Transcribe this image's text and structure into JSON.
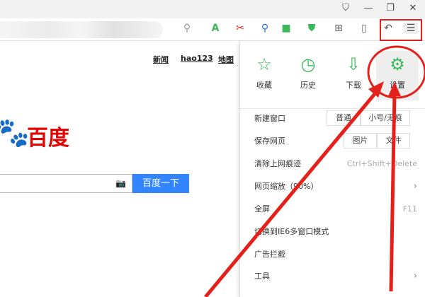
{
  "window": {
    "controls": [
      {
        "name": "skin-icon",
        "glyph": "👕"
      },
      {
        "name": "minimize-icon",
        "glyph": "—"
      },
      {
        "name": "restore-icon",
        "glyph": "❐"
      },
      {
        "name": "close-icon",
        "glyph": "✕"
      }
    ]
  },
  "toolbar": {
    "icons": [
      "search-icon",
      "translate-icon",
      "screenshot-icon",
      "find-icon",
      "game-icon",
      "security-icon",
      "apps-icon",
      "mobile-icon",
      "undo-icon",
      "menu-icon"
    ]
  },
  "page": {
    "links": [
      "新闻",
      "hao123",
      "地图"
    ],
    "logo_text": "百度",
    "search_button": "百度一下",
    "search_placeholder": ""
  },
  "menu": {
    "top": [
      {
        "label": "收藏",
        "icon": "star-icon"
      },
      {
        "label": "历史",
        "icon": "clock-icon"
      },
      {
        "label": "下载",
        "icon": "download-icon"
      },
      {
        "label": "设置",
        "icon": "gear-icon"
      }
    ],
    "new_window": {
      "label": "新建窗口",
      "options": [
        "普通",
        "小号/无痕"
      ]
    },
    "save_page": {
      "label": "保存网页",
      "options": [
        "图片",
        "文件"
      ]
    },
    "clear": {
      "label": "清除上网痕迹",
      "shortcut": "Ctrl+Shift+Delete"
    },
    "zoom": {
      "label": "网页缩放（90%）"
    },
    "fullscreen": {
      "label": "全屏",
      "shortcut": "F11"
    },
    "ie6": {
      "label": "切换到IE6多窗口模式"
    },
    "adblock": {
      "label": "广告拦截"
    },
    "tools": {
      "label": "工具"
    }
  },
  "colors": {
    "accent": "#3cb95b",
    "annotation": "#e5201a",
    "baidu_blue": "#3385ff"
  }
}
